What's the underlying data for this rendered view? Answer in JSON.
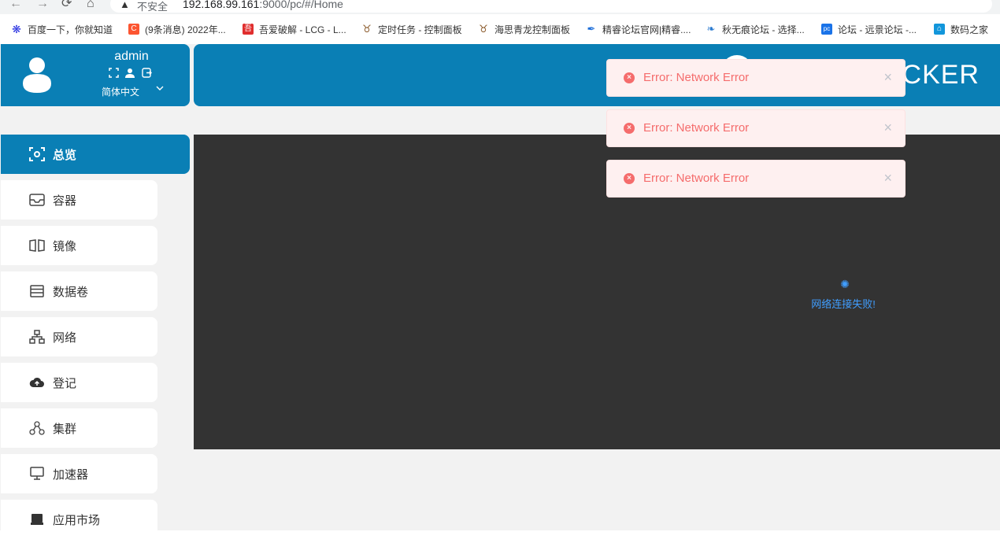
{
  "browser": {
    "back_icon": "arrow-left-icon",
    "security_label": "不安全",
    "url_prefix": "192.168.99.161",
    "url_rest": ":9000/pc/#/Home",
    "bookmarks": [
      {
        "label": "百度一下，你就知道",
        "icon": "paw-icon",
        "icon_color": "#2932e1"
      },
      {
        "label": "(9条消息) 2022年...",
        "icon": "csdn-icon",
        "icon_color": "#fc5531"
      },
      {
        "label": "吾爱破解 - LCG - L...",
        "icon": "52pojie-icon",
        "icon_color": "#e02e2e"
      },
      {
        "label": "定时任务 - 控制面板",
        "icon": "bull-icon",
        "icon_color": "#8a5a2b"
      },
      {
        "label": "海思青龙控制面板",
        "icon": "bull-icon",
        "icon_color": "#8a5a2b"
      },
      {
        "label": "精睿论坛官网|精睿....",
        "icon": "feather-icon",
        "icon_color": "#1e6fd9"
      },
      {
        "label": "秋无痕论坛 - 选择...",
        "icon": "leaf-icon",
        "icon_color": "#2b7bd0"
      },
      {
        "label": "论坛 - 远景论坛 -...",
        "icon": "pc-icon",
        "icon_color": "#1a73e8"
      },
      {
        "label": "数码之家",
        "icon": "house-icon",
        "icon_color": "#1296db"
      }
    ]
  },
  "user": {
    "name": "admin",
    "language": "简体中文"
  },
  "brand": {
    "text": "OCKER"
  },
  "menu": [
    {
      "label": "总览",
      "icon": "eye-scan-icon",
      "active": true
    },
    {
      "label": "容器",
      "icon": "inbox-icon",
      "active": false
    },
    {
      "label": "镜像",
      "icon": "book-open-icon",
      "active": false
    },
    {
      "label": "数据卷",
      "icon": "list-icon",
      "active": false
    },
    {
      "label": "网络",
      "icon": "network-icon",
      "active": false
    },
    {
      "label": "登记",
      "icon": "cloud-upload-icon",
      "active": false
    },
    {
      "label": "集群",
      "icon": "cluster-icon",
      "active": false
    },
    {
      "label": "加速器",
      "icon": "monitor-icon",
      "active": false
    },
    {
      "label": "应用市场",
      "icon": "store-icon",
      "active": false
    }
  ],
  "main": {
    "loading_text": "网络连接失败!"
  },
  "toasts": [
    {
      "message": "Error: Network Error"
    },
    {
      "message": "Error: Network Error"
    },
    {
      "message": "Error: Network Error"
    }
  ],
  "colors": {
    "primary": "#0a7fb5",
    "error": "#f56c6c",
    "error_bg": "#fef0f0",
    "content_bg": "#333333",
    "loading": "#409eff"
  }
}
